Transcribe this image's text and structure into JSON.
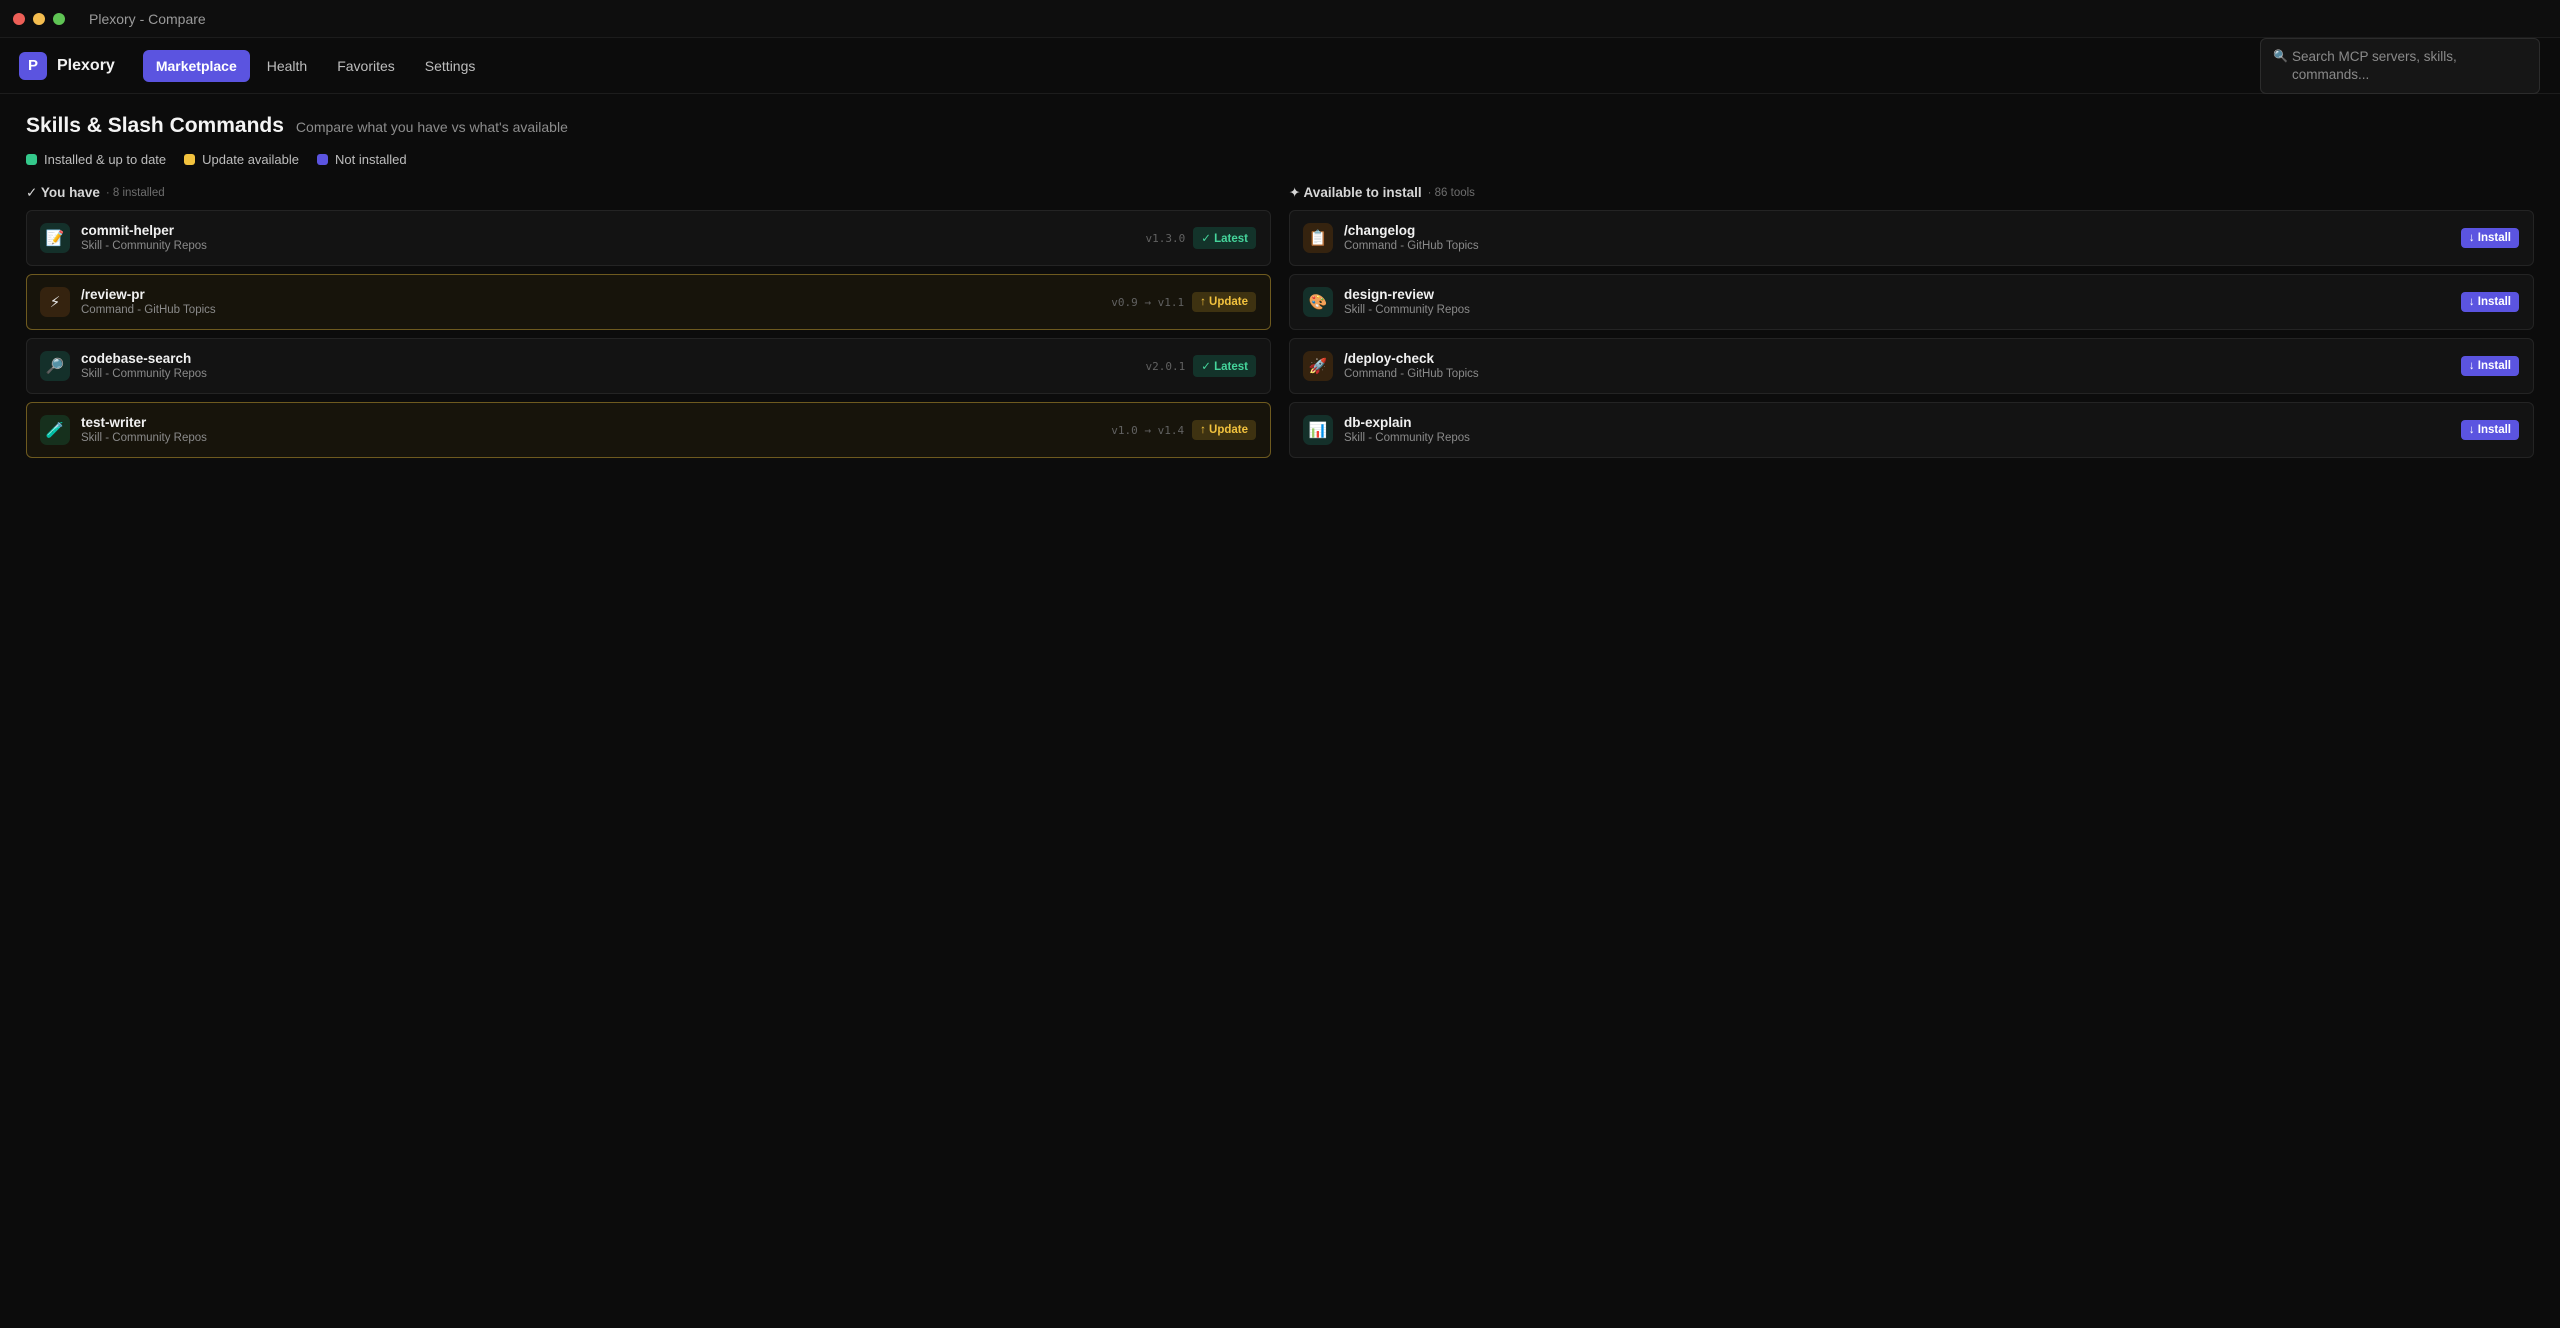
{
  "window": {
    "title": "Plexory - Compare"
  },
  "brand": {
    "logo_letter": "P",
    "name": "Plexory"
  },
  "nav": {
    "tabs": [
      "Marketplace",
      "Health",
      "Favorites",
      "Settings"
    ],
    "active": "Marketplace"
  },
  "search": {
    "placeholder": "Search MCP servers, skills, commands...",
    "icon": "search-icon"
  },
  "header": {
    "title": "Skills & Slash Commands",
    "subtitle": "Compare what you have vs what's available"
  },
  "legend": [
    {
      "label": "Installed & up to date",
      "color": "#34c98b"
    },
    {
      "label": "Update available",
      "color": "#f2c23e"
    },
    {
      "label": "Not installed",
      "color": "#5b54e0"
    }
  ],
  "installed": {
    "title": "✓ You have",
    "count": "· 8 installed",
    "items": [
      {
        "name": "commit-helper",
        "meta": "Skill - Community Repos",
        "icon": "📝",
        "icon_name": "memo-icon",
        "version": "v1.3.0",
        "status": "latest",
        "action": "✓ Latest"
      },
      {
        "name": "/review-pr",
        "meta": "Command - GitHub Topics",
        "icon": "⚡",
        "icon_name": "lightning-icon",
        "version": "v0.9 → v1.1",
        "status": "update",
        "action": "↑ Update"
      },
      {
        "name": "codebase-search",
        "meta": "Skill - Community Repos",
        "icon": "🔎",
        "icon_name": "magnifier-icon",
        "version": "v2.0.1",
        "status": "latest",
        "action": "✓ Latest"
      },
      {
        "name": "test-writer",
        "meta": "Skill - Community Repos",
        "icon": "🧪",
        "icon_name": "test-tube-icon",
        "version": "v1.0 → v1.4",
        "status": "update",
        "action": "↑ Update"
      }
    ]
  },
  "available": {
    "title": "✦ Available to install",
    "count": "· 86 tools",
    "items": [
      {
        "name": "/changelog",
        "meta": "Command - GitHub Topics",
        "icon": "📋",
        "icon_name": "clipboard-icon",
        "action": "↓ Install"
      },
      {
        "name": "design-review",
        "meta": "Skill - Community Repos",
        "icon": "🎨",
        "icon_name": "palette-icon",
        "action": "↓ Install"
      },
      {
        "name": "/deploy-check",
        "meta": "Command - GitHub Topics",
        "icon": "🚀",
        "icon_name": "rocket-icon",
        "action": "↓ Install"
      },
      {
        "name": "db-explain",
        "meta": "Skill - Community Repos",
        "icon": "📊",
        "icon_name": "bar-chart-icon",
        "action": "↓ Install"
      }
    ]
  }
}
